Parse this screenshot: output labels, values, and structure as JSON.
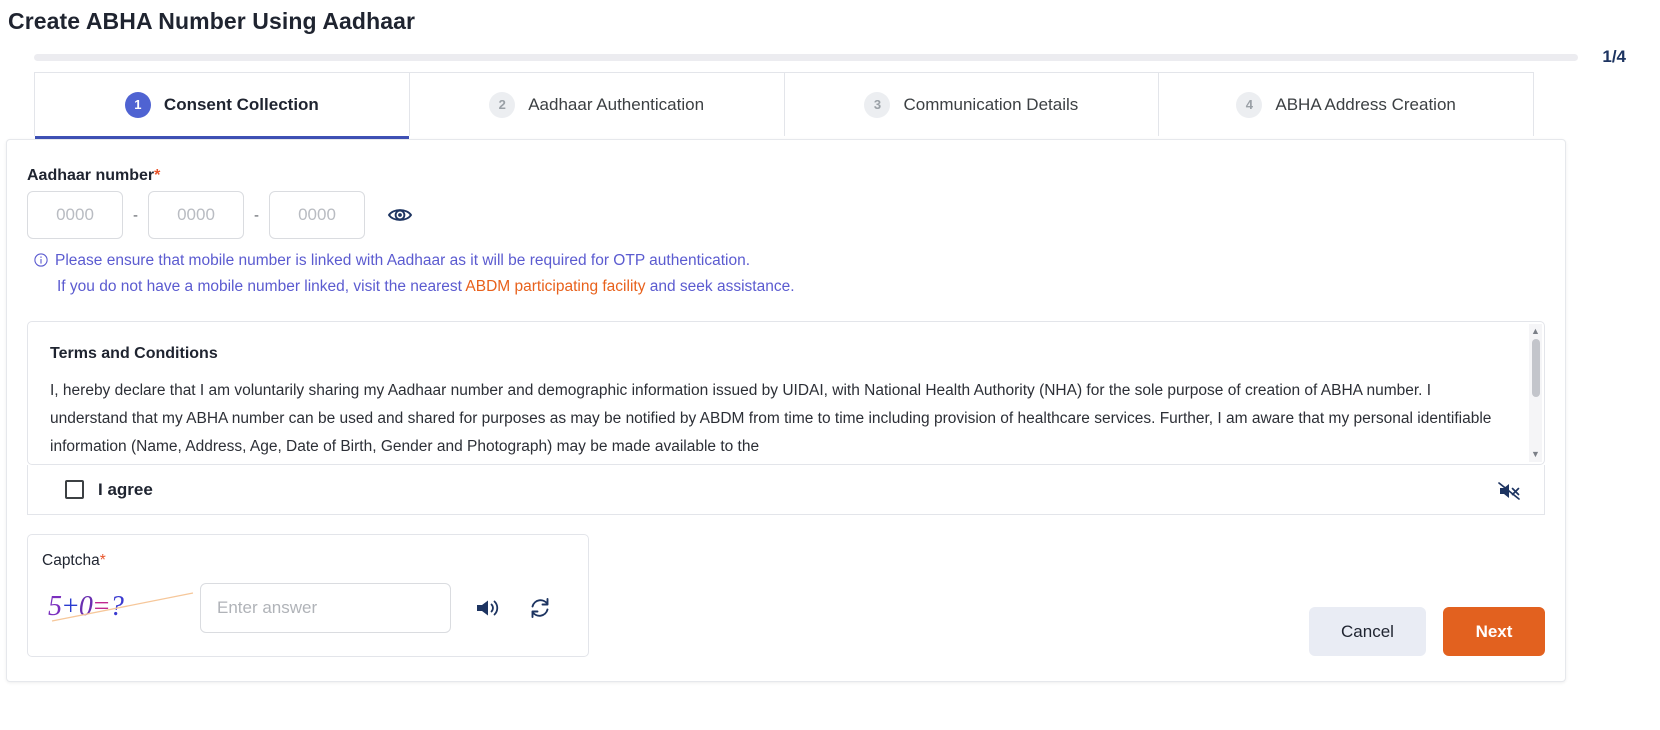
{
  "header": {
    "title": "Create ABHA Number Using Aadhaar",
    "progress_count": "1/4",
    "progress_percent": 25
  },
  "steps": [
    {
      "number": "1",
      "label": "Consent Collection"
    },
    {
      "number": "2",
      "label": "Aadhaar Authentication"
    },
    {
      "number": "3",
      "label": "Communication Details"
    },
    {
      "number": "4",
      "label": "ABHA Address Creation"
    }
  ],
  "aadhaar": {
    "label": "Aadhaar number",
    "required_mark": "*",
    "placeholder_1": "0000",
    "placeholder_2": "0000",
    "placeholder_3": "0000",
    "value_1": "",
    "value_2": "",
    "value_3": "",
    "separator": "-",
    "toggle_icon": "eye-icon"
  },
  "info": {
    "icon": "info-circle-icon",
    "line1": "Please ensure that mobile number is linked with Aadhaar as it will be required for OTP authentication.",
    "line2_prefix": "If you do not have a mobile number linked, visit the nearest ",
    "line2_link": "ABDM participating facility",
    "line2_suffix": " and seek assistance."
  },
  "terms": {
    "title": "Terms and Conditions",
    "body": "I, hereby declare that I am voluntarily sharing my Aadhaar number and demographic information issued by UIDAI, with National Health Authority (NHA) for the sole purpose of creation of ABHA number. I understand that my ABHA number can be used and shared for purposes as may be notified by ABDM from time to time including provision of healthcare services. Further, I am aware that my personal identifiable information (Name, Address, Age, Date of Birth, Gender and Photograph) may be made available to the"
  },
  "agree": {
    "label": "I agree",
    "checked": false,
    "mute_icon": "speaker-mute-icon"
  },
  "captcha": {
    "label": "Captcha",
    "required_mark": "*",
    "challenge": "5+0=?",
    "chars": [
      "5",
      "+",
      "0",
      "=",
      "?"
    ],
    "input_placeholder": "Enter answer",
    "input_value": "",
    "speaker_icon": "speaker-icon",
    "refresh_icon": "refresh-icon"
  },
  "footer": {
    "cancel_label": "Cancel",
    "next_label": "Next"
  },
  "colors": {
    "accent_orange": "#e2611f",
    "accent_blue": "#4f63d2",
    "info_purple": "#5b5bd0",
    "link_orange": "#e8611c",
    "progress_count": "#1d3461"
  }
}
